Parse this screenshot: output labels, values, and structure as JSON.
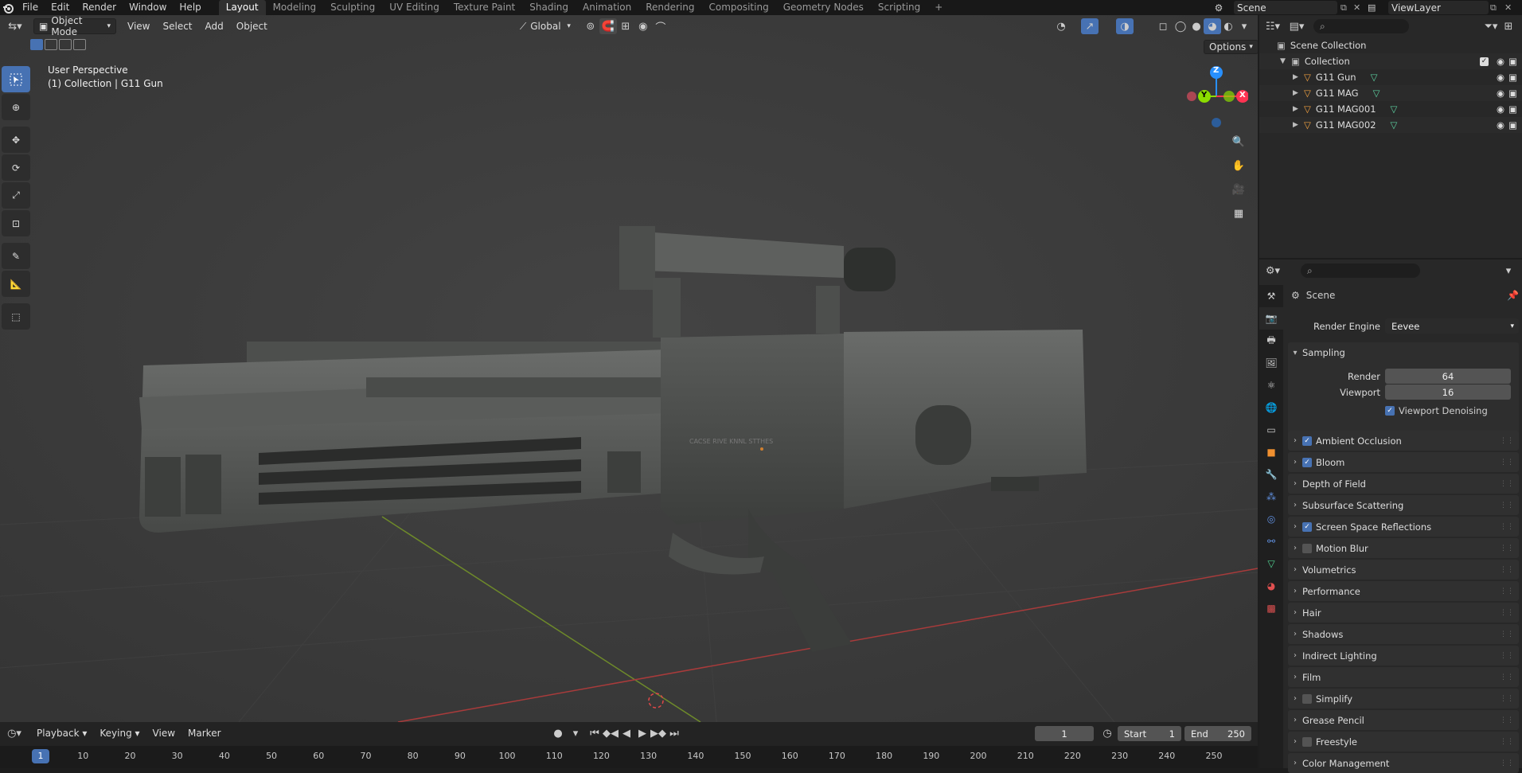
{
  "topbar": {
    "menus": [
      "File",
      "Edit",
      "Render",
      "Window",
      "Help"
    ],
    "workspaces": [
      "Layout",
      "Modeling",
      "Sculpting",
      "UV Editing",
      "Texture Paint",
      "Shading",
      "Animation",
      "Rendering",
      "Compositing",
      "Geometry Nodes",
      "Scripting"
    ],
    "active_workspace": "Layout",
    "add_tab": "+",
    "scene": "Scene",
    "view_layer": "ViewLayer"
  },
  "viewport": {
    "mode": "Object Mode",
    "menus": [
      "View",
      "Select",
      "Add",
      "Object"
    ],
    "orientation": "Global",
    "options": "Options",
    "perspective": "User Perspective",
    "collection_info": "(1) Collection | G11 Gun",
    "gizmo": {
      "z": "Z",
      "y": "Y",
      "x": "X"
    }
  },
  "outliner": {
    "root": "Scene Collection",
    "collection": "Collection",
    "objects": [
      "G11 Gun",
      "G11 MAG",
      "G11 MAG001",
      "G11 MAG002"
    ]
  },
  "properties": {
    "context": "Scene",
    "render_engine_label": "Render Engine",
    "render_engine": "Eevee",
    "sampling": {
      "title": "Sampling",
      "render_label": "Render",
      "render_value": "64",
      "viewport_label": "Viewport",
      "viewport_value": "16",
      "denoise": "Viewport Denoising"
    },
    "panels": [
      {
        "label": "Ambient Occlusion",
        "checkbox": true,
        "checked": true
      },
      {
        "label": "Bloom",
        "checkbox": true,
        "checked": true
      },
      {
        "label": "Depth of Field",
        "checkbox": false,
        "checked": false
      },
      {
        "label": "Subsurface Scattering",
        "checkbox": false,
        "checked": false
      },
      {
        "label": "Screen Space Reflections",
        "checkbox": true,
        "checked": true
      },
      {
        "label": "Motion Blur",
        "checkbox": true,
        "checked": false
      },
      {
        "label": "Volumetrics",
        "checkbox": false,
        "checked": false
      },
      {
        "label": "Performance",
        "checkbox": false,
        "checked": false
      },
      {
        "label": "Hair",
        "checkbox": false,
        "checked": false
      },
      {
        "label": "Shadows",
        "checkbox": false,
        "checked": false
      },
      {
        "label": "Indirect Lighting",
        "checkbox": false,
        "checked": false
      },
      {
        "label": "Film",
        "checkbox": false,
        "checked": false
      },
      {
        "label": "Simplify",
        "checkbox": true,
        "checked": false
      },
      {
        "label": "Grease Pencil",
        "checkbox": false,
        "checked": false
      },
      {
        "label": "Freestyle",
        "checkbox": true,
        "checked": false
      },
      {
        "label": "Color Management",
        "checkbox": false,
        "checked": false
      }
    ]
  },
  "timeline": {
    "menus": [
      "Playback",
      "Keying",
      "View",
      "Marker"
    ],
    "current_frame": "1",
    "start_label": "Start",
    "start": "1",
    "end_label": "End",
    "end": "250",
    "ruler": [
      "1",
      "10",
      "20",
      "30",
      "40",
      "50",
      "60",
      "70",
      "80",
      "90",
      "100",
      "110",
      "120",
      "130",
      "140",
      "150",
      "160",
      "170",
      "180",
      "190",
      "200",
      "210",
      "220",
      "230",
      "240",
      "250"
    ]
  },
  "gun_markings": "CACSE  RIVE  KNNL  STTHES",
  "colors": {
    "accent": "#4772b3",
    "x_axis": "#ff3352",
    "y_axis": "#8bdc00",
    "z_axis": "#2890ff"
  }
}
